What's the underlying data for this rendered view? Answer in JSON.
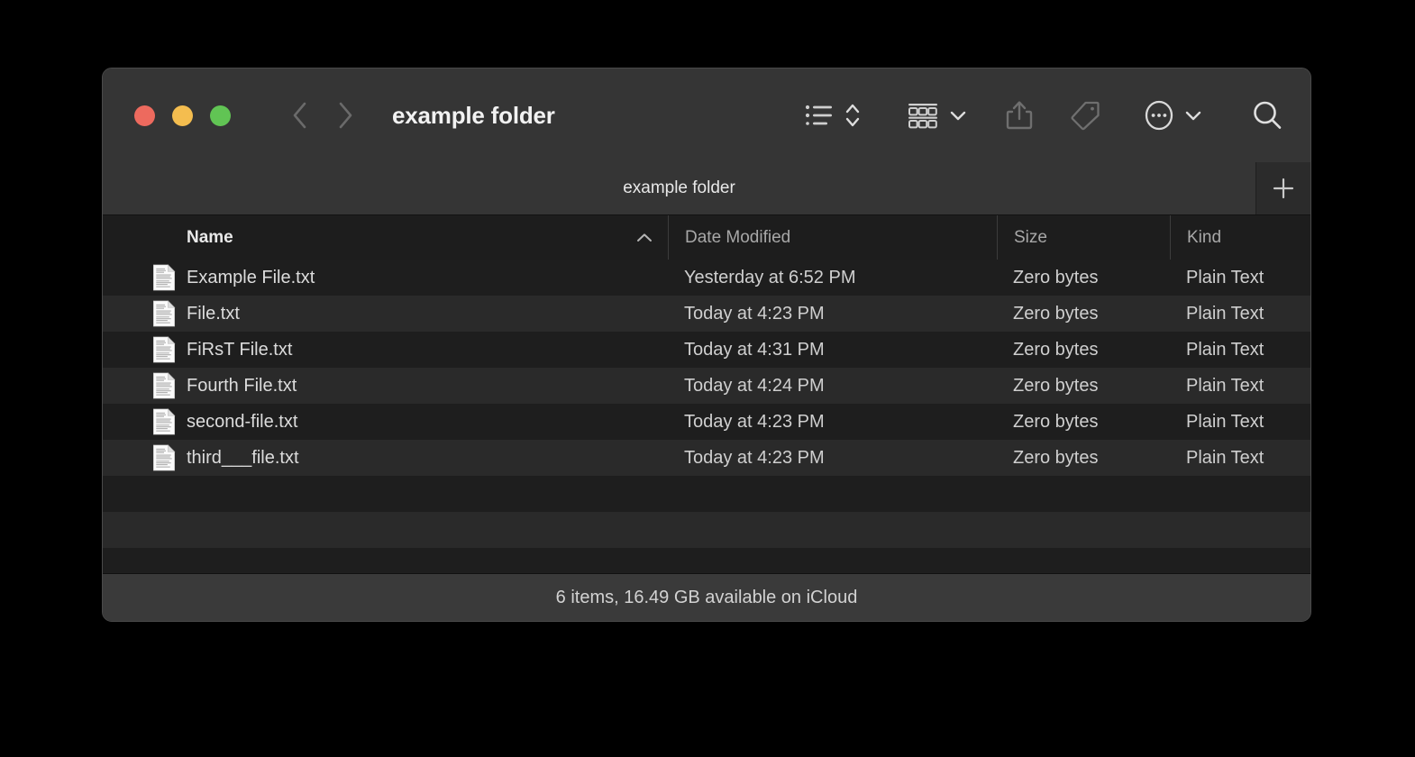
{
  "window": {
    "title": "example folder",
    "traffic_lights": [
      {
        "name": "close",
        "color": "#ED6A5E"
      },
      {
        "name": "minimize",
        "color": "#F4BD4F"
      },
      {
        "name": "maximize",
        "color": "#61C454"
      }
    ]
  },
  "toolbar": {
    "back_icon": "chevron-left-icon",
    "forward_icon": "chevron-right-icon",
    "view_list_icon": "list-view-icon",
    "sort_icon": "sort-updown-icon",
    "group_icon": "group-by-icon",
    "group_chevron_icon": "chevron-down-icon",
    "share_icon": "share-icon",
    "tag_icon": "tag-icon",
    "more_icon": "more-ellipsis-icon",
    "more_chevron_icon": "chevron-down-icon",
    "search_icon": "search-icon"
  },
  "tabbar": {
    "tabs": [
      {
        "label": "example folder",
        "active": true
      }
    ],
    "new_tab_label": "+"
  },
  "columns": [
    {
      "key": "name",
      "label": "Name",
      "sorted": true,
      "sort_direction": "ascending"
    },
    {
      "key": "date",
      "label": "Date Modified",
      "sorted": false
    },
    {
      "key": "size",
      "label": "Size",
      "sorted": false
    },
    {
      "key": "kind",
      "label": "Kind",
      "sorted": false
    }
  ],
  "files": [
    {
      "icon": "plain-text-file-icon",
      "name": "Example File.txt",
      "date": "Yesterday at 6:52 PM",
      "size": "Zero bytes",
      "kind": "Plain Text"
    },
    {
      "icon": "plain-text-file-icon",
      "name": "File.txt",
      "date": "Today at 4:23 PM",
      "size": "Zero bytes",
      "kind": "Plain Text"
    },
    {
      "icon": "plain-text-file-icon",
      "name": "FiRsT File.txt",
      "date": "Today at 4:31 PM",
      "size": "Zero bytes",
      "kind": "Plain Text"
    },
    {
      "icon": "plain-text-file-icon",
      "name": "Fourth File.txt",
      "date": "Today at 4:24 PM",
      "size": "Zero bytes",
      "kind": "Plain Text"
    },
    {
      "icon": "plain-text-file-icon",
      "name": "second-file.txt",
      "date": "Today at 4:23 PM",
      "size": "Zero bytes",
      "kind": "Plain Text"
    },
    {
      "icon": "plain-text-file-icon",
      "name": "third___file.txt",
      "date": "Today at 4:23 PM",
      "size": "Zero bytes",
      "kind": "Plain Text"
    }
  ],
  "statusbar": {
    "text": "6 items, 16.49 GB available on iCloud"
  },
  "colors": {
    "desktop_background": "#000000",
    "window_chrome": "#353535",
    "list_background": "#1e1e1e",
    "row_alt_background": "#2a2a2a",
    "column_header_background": "#1d1d1d",
    "statusbar_background": "#3a3a3a",
    "text_primary": "#e9e9e9",
    "text_secondary": "#a8a8a8",
    "icon_dim": "#6a6a6a"
  }
}
